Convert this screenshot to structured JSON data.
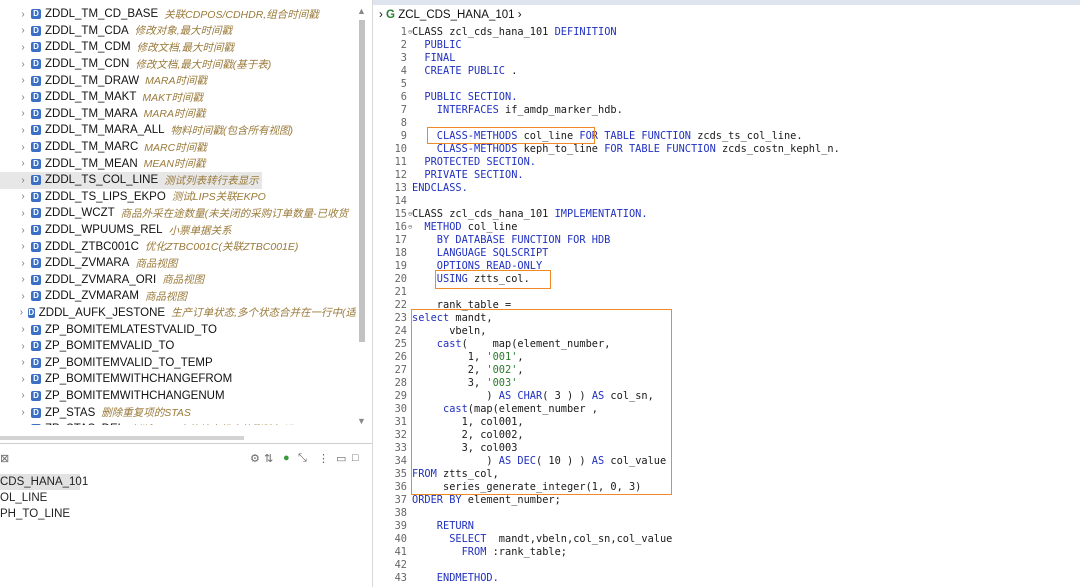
{
  "tree": {
    "items": [
      {
        "name": "ZDDL_TM_CD_BASE",
        "desc": "关联CDPOS/CDHDR,组合时间戳"
      },
      {
        "name": "ZDDL_TM_CDA",
        "desc": "修改对象,最大时间戳"
      },
      {
        "name": "ZDDL_TM_CDM",
        "desc": "修改文档,最大时间戳"
      },
      {
        "name": "ZDDL_TM_CDN",
        "desc": "修改文档,最大时间戳(基于表)"
      },
      {
        "name": "ZDDL_TM_DRAW",
        "desc": "MARA时间戳"
      },
      {
        "name": "ZDDL_TM_MAKT",
        "desc": "MAKT时间戳"
      },
      {
        "name": "ZDDL_TM_MARA",
        "desc": "MARA时间戳"
      },
      {
        "name": "ZDDL_TM_MARA_ALL",
        "desc": "物料时间戳(包含所有视图)"
      },
      {
        "name": "ZDDL_TM_MARC",
        "desc": "MARC时间戳"
      },
      {
        "name": "ZDDL_TM_MEAN",
        "desc": "MEAN时间戳"
      },
      {
        "name": "ZDDL_TS_COL_LINE",
        "desc": "测试列表转行表显示",
        "selected": true
      },
      {
        "name": "ZDDL_TS_LIPS_EKPO",
        "desc": "测试LIPS关联EKPO"
      },
      {
        "name": "ZDDL_WCZT",
        "desc": "商品外采在途数量(未关闭的采购订单数量-已收货"
      },
      {
        "name": "ZDDL_WPUUMS_REL",
        "desc": "小票单据关系"
      },
      {
        "name": "ZDDL_ZTBC001C",
        "desc": "优化ZTBC001C(关联ZTBC001E)"
      },
      {
        "name": "ZDDL_ZVMARA",
        "desc": "商品视图"
      },
      {
        "name": "ZDDL_ZVMARA_ORI",
        "desc": "商品视图"
      },
      {
        "name": "ZDDL_ZVMARAM",
        "desc": "商品视图"
      },
      {
        "name": "ZDDL_AUFK_JESTONE",
        "desc": "生产订单状态,多个状态合并在一行中(适"
      },
      {
        "name": "ZP_BOMITEMLATESTVALID_TO",
        "desc": ""
      },
      {
        "name": "ZP_BOMITEMVALID_TO",
        "desc": ""
      },
      {
        "name": "ZP_BOMITEMVALID_TO_TEMP",
        "desc": ""
      },
      {
        "name": "ZP_BOMITEMWITHCHANGEFROM",
        "desc": ""
      },
      {
        "name": "ZP_BOMITEMWITHCHANGENUM",
        "desc": ""
      },
      {
        "name": "ZP_STAS",
        "desc": "删除重复项的STAS"
      },
      {
        "name": "ZP_STAS_DEL",
        "desc": "判断STAS中的特定组合的删除标记"
      }
    ]
  },
  "outline": {
    "toolbar_close": "⊠",
    "items": [
      {
        "label": "CDS_HANA_101",
        "selected": true
      },
      {
        "label": "OL_LINE"
      },
      {
        "label": "PH_TO_LINE"
      }
    ]
  },
  "editor": {
    "breadcrumb": "ZCL_CDS_HANA_101",
    "lines": [
      {
        "n": "1",
        "fold": true,
        "parts": [
          [
            "ct",
            "CLASS zcl_cds_hana_101 "
          ],
          [
            "kw",
            "DEFINITION"
          ]
        ]
      },
      {
        "n": "2",
        "parts": [
          [
            "kw",
            "  PUBLIC"
          ]
        ]
      },
      {
        "n": "3",
        "parts": [
          [
            "kw",
            "  FINAL"
          ]
        ]
      },
      {
        "n": "4",
        "parts": [
          [
            "kw",
            "  CREATE PUBLIC "
          ],
          [
            "ct",
            "."
          ]
        ]
      },
      {
        "n": "5",
        "parts": []
      },
      {
        "n": "6",
        "parts": [
          [
            "kw",
            "  PUBLIC SECTION."
          ]
        ]
      },
      {
        "n": "7",
        "parts": [
          [
            "kw",
            "    INTERFACES "
          ],
          [
            "ct",
            "if_amdp_marker_hdb."
          ]
        ]
      },
      {
        "n": "8",
        "parts": []
      },
      {
        "n": "9",
        "parts": [
          [
            "kw",
            "    CLASS-METHODS "
          ],
          [
            "ct",
            "col_line "
          ],
          [
            "kw",
            "FOR TABLE FUNCTION "
          ],
          [
            "ct",
            "zcds_ts_col_line."
          ]
        ]
      },
      {
        "n": "10",
        "parts": [
          [
            "kw",
            "    CLASS-METHODS "
          ],
          [
            "ct",
            "keph_to_line "
          ],
          [
            "kw",
            "FOR TABLE FUNCTION "
          ],
          [
            "ct",
            "zcds_costn_kephl_n."
          ]
        ]
      },
      {
        "n": "11",
        "parts": [
          [
            "kw",
            "  PROTECTED SECTION."
          ]
        ]
      },
      {
        "n": "12",
        "parts": [
          [
            "kw",
            "  PRIVATE SECTION."
          ]
        ]
      },
      {
        "n": "13",
        "parts": [
          [
            "kw",
            "ENDCLASS."
          ]
        ]
      },
      {
        "n": "14",
        "parts": []
      },
      {
        "n": "15",
        "fold": true,
        "parts": [
          [
            "ct",
            "CLASS zcl_cds_hana_101 "
          ],
          [
            "kw",
            "IMPLEMENTATION."
          ]
        ]
      },
      {
        "n": "16",
        "fold": true,
        "parts": [
          [
            "kw",
            "  METHOD "
          ],
          [
            "ct",
            "col_line"
          ]
        ]
      },
      {
        "n": "17",
        "parts": [
          [
            "kw",
            "    BY DATABASE FUNCTION FOR HDB"
          ]
        ]
      },
      {
        "n": "18",
        "parts": [
          [
            "kw",
            "    LANGUAGE SQLSCRIPT"
          ]
        ]
      },
      {
        "n": "19",
        "parts": [
          [
            "kw",
            "    OPTIONS READ-ONLY"
          ]
        ]
      },
      {
        "n": "20",
        "parts": [
          [
            "kw",
            "    USING "
          ],
          [
            "ct",
            "ztts_col."
          ]
        ]
      },
      {
        "n": "21",
        "parts": []
      },
      {
        "n": "22",
        "parts": [
          [
            "ct",
            "    rank_table ="
          ]
        ]
      },
      {
        "n": "23",
        "parts": [
          [
            "kw",
            "select "
          ],
          [
            "ct",
            "mandt,"
          ]
        ]
      },
      {
        "n": "24",
        "parts": [
          [
            "ct",
            "      vbeln,"
          ]
        ]
      },
      {
        "n": "25",
        "parts": [
          [
            "kw",
            "    cast"
          ],
          [
            "ct",
            "(    map(element_number,"
          ]
        ]
      },
      {
        "n": "26",
        "parts": [
          [
            "ct",
            "         1, "
          ],
          [
            "st",
            "'001'"
          ],
          [
            "ct",
            ","
          ]
        ]
      },
      {
        "n": "27",
        "parts": [
          [
            "ct",
            "         2, "
          ],
          [
            "st",
            "'002'"
          ],
          [
            "ct",
            ","
          ]
        ]
      },
      {
        "n": "28",
        "parts": [
          [
            "ct",
            "         3, "
          ],
          [
            "st",
            "'003'"
          ]
        ]
      },
      {
        "n": "29",
        "parts": [
          [
            "ct",
            "            ) "
          ],
          [
            "kw",
            "AS CHAR"
          ],
          [
            "ct",
            "( 3 ) ) "
          ],
          [
            "kw",
            "AS "
          ],
          [
            "ct",
            "col_sn,"
          ]
        ]
      },
      {
        "n": "30",
        "parts": [
          [
            "kw",
            "     cast"
          ],
          [
            "ct",
            "(map(element_number ,"
          ]
        ]
      },
      {
        "n": "31",
        "parts": [
          [
            "ct",
            "        1, col001,"
          ]
        ]
      },
      {
        "n": "32",
        "parts": [
          [
            "ct",
            "        2, col002,"
          ]
        ]
      },
      {
        "n": "33",
        "parts": [
          [
            "ct",
            "        3, col003"
          ]
        ]
      },
      {
        "n": "34",
        "parts": [
          [
            "ct",
            "            ) "
          ],
          [
            "kw",
            "AS DEC"
          ],
          [
            "ct",
            "( 10 ) ) "
          ],
          [
            "kw",
            "AS "
          ],
          [
            "ct",
            "col_value"
          ]
        ]
      },
      {
        "n": "35",
        "parts": [
          [
            "kw",
            "FROM "
          ],
          [
            "ct",
            "ztts_col,"
          ]
        ]
      },
      {
        "n": "36",
        "parts": [
          [
            "ct",
            "     series_generate_integer(1, 0, 3)"
          ]
        ]
      },
      {
        "n": "37",
        "parts": [
          [
            "kw",
            "ORDER BY "
          ],
          [
            "ct",
            "element_number;"
          ]
        ]
      },
      {
        "n": "38",
        "parts": []
      },
      {
        "n": "39",
        "parts": [
          [
            "kw",
            "    RETURN"
          ]
        ]
      },
      {
        "n": "40",
        "parts": [
          [
            "kw",
            "      SELECT  "
          ],
          [
            "ct",
            "mandt,vbeln,col_sn,col_value"
          ]
        ]
      },
      {
        "n": "41",
        "parts": [
          [
            "kw",
            "        FROM "
          ],
          [
            "ct",
            ":rank_table;"
          ]
        ]
      },
      {
        "n": "42",
        "parts": []
      },
      {
        "n": "43",
        "parts": [
          [
            "kw",
            "    ENDMETHOD."
          ]
        ]
      }
    ]
  }
}
